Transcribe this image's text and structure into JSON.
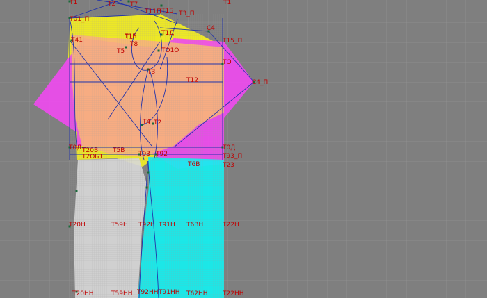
{
  "editor": {
    "background_color": "#7f7f7f",
    "grid_color": "#8e8e8e",
    "fine_grid_color": "#dcdcdc",
    "line_color": "#2233aa",
    "label_color": "#c00000",
    "point_color": "#1a6a3a"
  },
  "pattern": {
    "panels": [
      {
        "name": "yellow-panel",
        "color": "#f6f11e"
      },
      {
        "name": "magenta-panel",
        "color": "#ee4bee"
      },
      {
        "name": "orange-panel",
        "color": "#f7b37a"
      },
      {
        "name": "cyan-panel",
        "color": "#14f0f0"
      },
      {
        "name": "gray-panel",
        "color": "#d7d7d7"
      }
    ],
    "labels": [
      "T1",
      "T2",
      "T7",
      "T11П",
      "T3_П",
      "T1",
      "T01_П",
      "T1Б",
      "T1Д",
      "C4",
      "T15_П",
      "T8",
      "T5",
      "T41",
      "TО1О",
      "T1",
      "TО",
      "T1Б",
      "TЗ",
      "T12",
      "C4_П",
      "T4",
      "T2",
      "T0Д",
      "T20В",
      "T2ОБ1",
      "T5В",
      "T93",
      "T92",
      "T0Д",
      "T93_П",
      "T6В",
      "T23",
      "T20Н",
      "T59Н",
      "T92Н",
      "T91Н",
      "T6ВН",
      "T22Н",
      "T20НН",
      "T59НН",
      "T92НН",
      "T91НН",
      "T62НН",
      "T22НН"
    ]
  }
}
